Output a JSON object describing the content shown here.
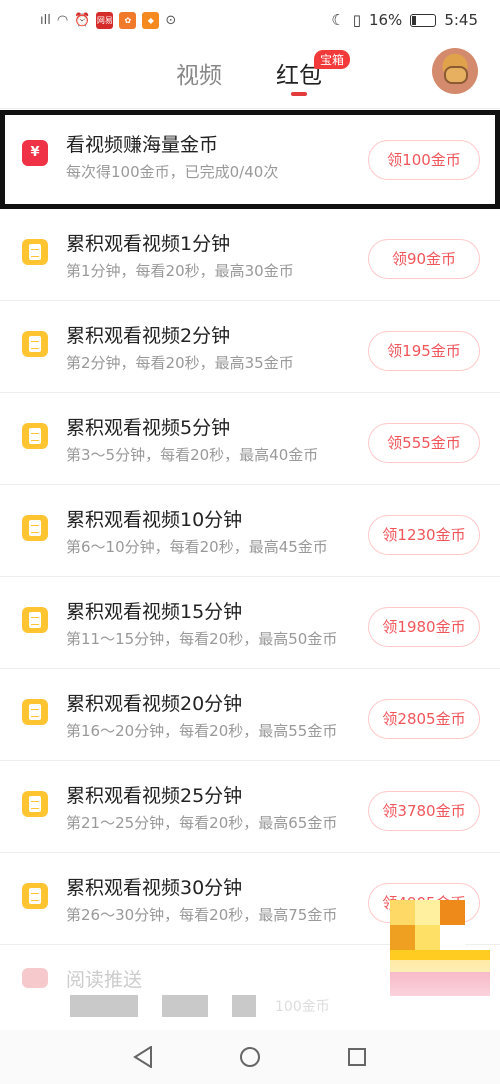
{
  "status_bar": {
    "battery": "16%",
    "time": "5:45",
    "app_badges": [
      "网易",
      "",
      ""
    ]
  },
  "header": {
    "tabs": [
      {
        "label": "视频",
        "active": false
      },
      {
        "label": "红包",
        "active": true
      }
    ],
    "badge": "宝箱"
  },
  "tasks": [
    {
      "icon": "coin-icon",
      "title": "看视频赚海量金币",
      "subtitle": "每次得100金币，已完成0/40次",
      "button": "领100金币",
      "highlighted": true
    },
    {
      "icon": "document-icon",
      "title": "累积观看视频1分钟",
      "subtitle": "第1分钟，每看20秒，最高30金币",
      "button": "领90金币"
    },
    {
      "icon": "document-icon",
      "title": "累积观看视频2分钟",
      "subtitle": "第2分钟，每看20秒，最高35金币",
      "button": "领195金币"
    },
    {
      "icon": "document-icon",
      "title": "累积观看视频5分钟",
      "subtitle": "第3～5分钟，每看20秒，最高40金币",
      "button": "领555金币"
    },
    {
      "icon": "document-icon",
      "title": "累积观看视频10分钟",
      "subtitle": "第6～10分钟，每看20秒，最高45金币",
      "button": "领1230金币"
    },
    {
      "icon": "document-icon",
      "title": "累积观看视频15分钟",
      "subtitle": "第11～15分钟，每看20秒，最高50金币",
      "button": "领1980金币"
    },
    {
      "icon": "document-icon",
      "title": "累积观看视频20分钟",
      "subtitle": "第16～20分钟，每看20秒，最高55金币",
      "button": "领2805金币"
    },
    {
      "icon": "document-icon",
      "title": "累积观看视频25分钟",
      "subtitle": "第21～25分钟，每看20秒，最高65金币",
      "button": "领3780金币"
    },
    {
      "icon": "document-icon",
      "title": "累积观看视频30分钟",
      "subtitle": "第26～30分钟，每看20秒，最高75金币",
      "button": "领4905金币"
    }
  ],
  "partial_row": {
    "title": "阅读推送",
    "coin": "100金币"
  },
  "colors": {
    "accent": "#f0555a",
    "tab_underline": "#e33b3b",
    "doc_icon": "#ffc431",
    "coin_icon": "#ef3246"
  }
}
